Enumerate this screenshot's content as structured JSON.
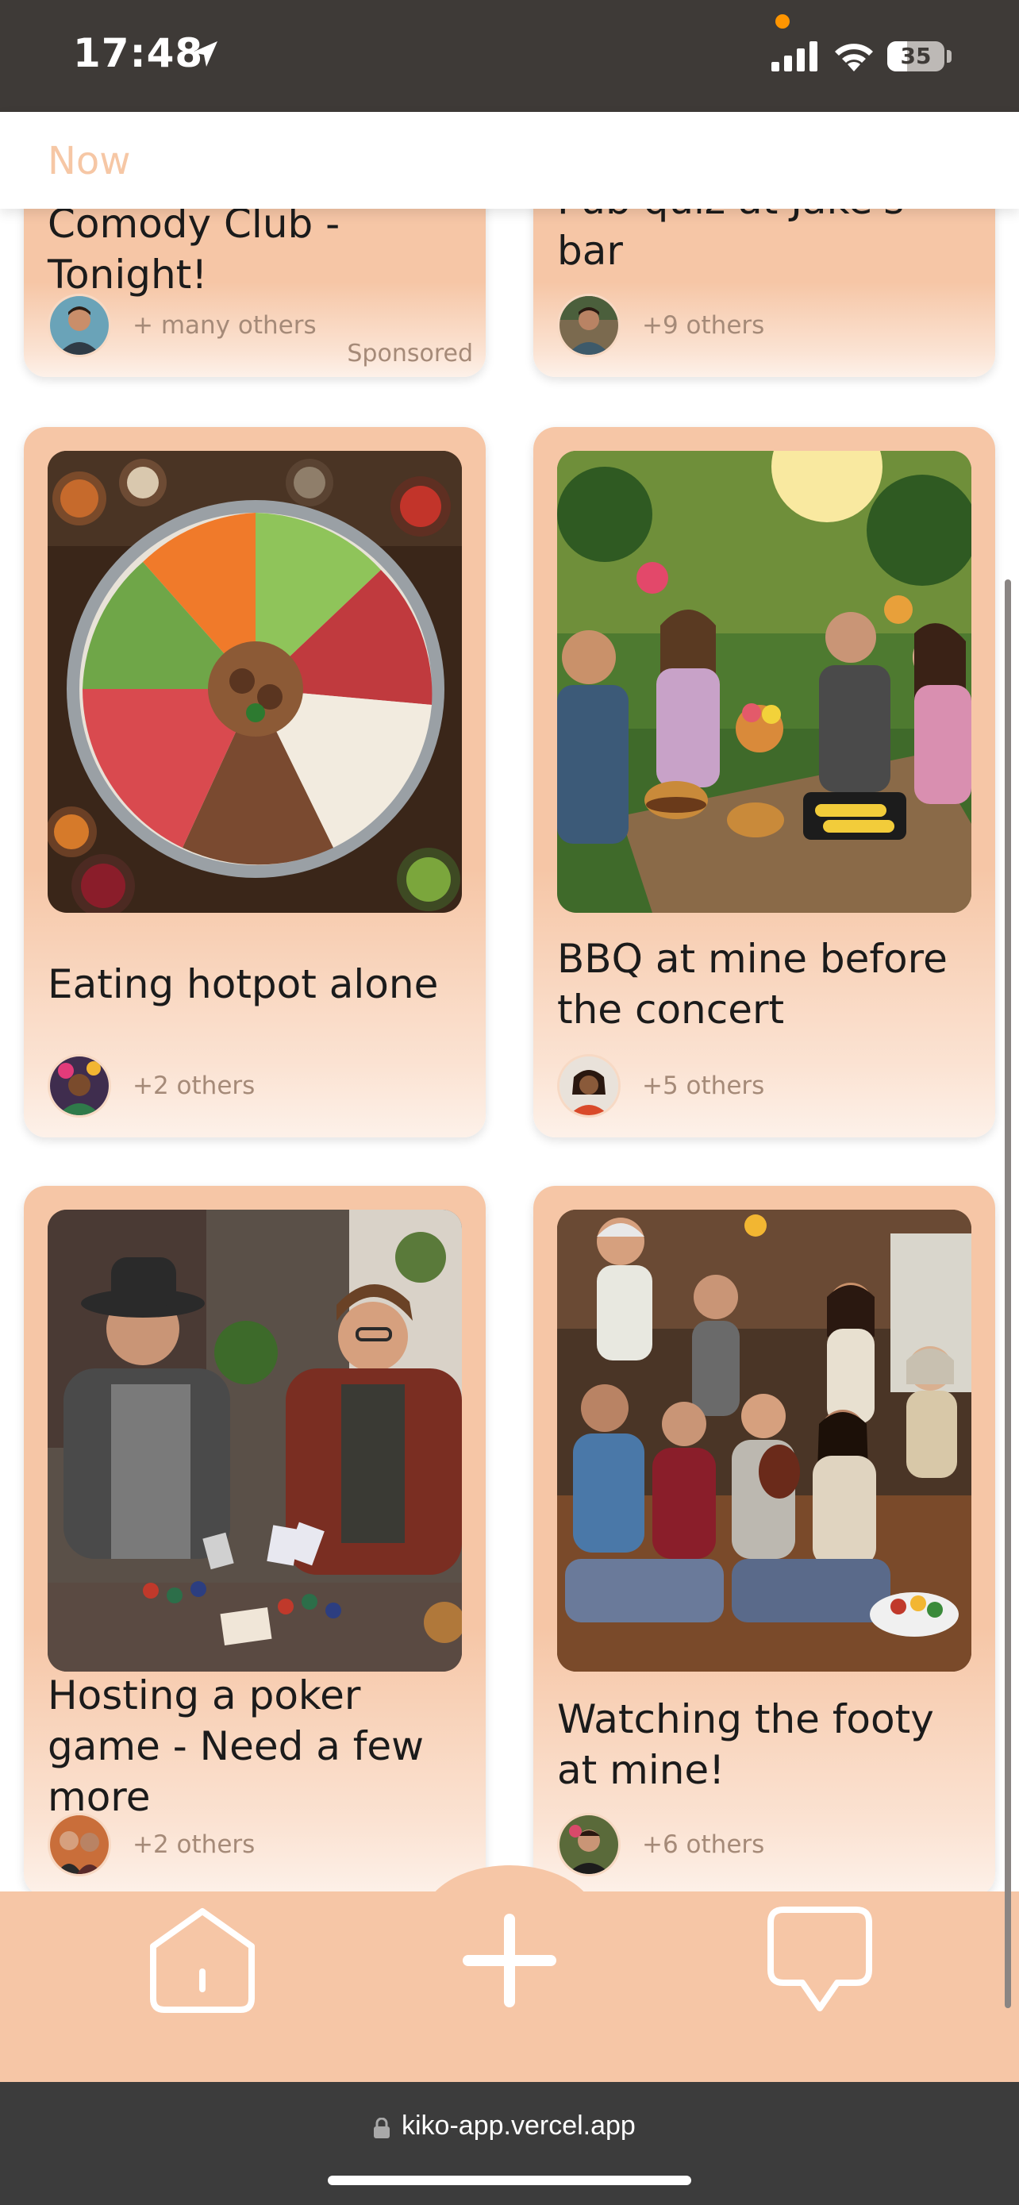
{
  "status_bar": {
    "time": "17:48",
    "battery": "35",
    "battery_level": 0.35,
    "icons": [
      "location-arrow-icon",
      "signal-icon",
      "wifi-icon",
      "battery-icon"
    ]
  },
  "header": {
    "title": "Now"
  },
  "cards": [
    {
      "title": "Comody Club - Tonight!",
      "others": "+ many others",
      "badge": "Sponsored"
    },
    {
      "title": "Pub quiz at Jake's bar",
      "others": "+9 others"
    },
    {
      "title": "Eating hotpot alone",
      "others": "+2 others"
    },
    {
      "title": "BBQ at mine before the concert",
      "others": "+5 others"
    },
    {
      "title": "Hosting a poker game - Need a few more",
      "others": "+2 others"
    },
    {
      "title": "Watching the footy at mine!",
      "others": "+6 others"
    }
  ],
  "bottom_nav": {
    "icons": [
      "home-icon",
      "plus-icon",
      "chat-bubble-icon"
    ]
  },
  "browser": {
    "url": "kiko-app.vercel.app"
  },
  "colors": {
    "accent": "#f6c6a6",
    "header_text": "#f6c7a5",
    "status_bar": "#3e3a37",
    "url_bar": "#3c3c3c"
  }
}
